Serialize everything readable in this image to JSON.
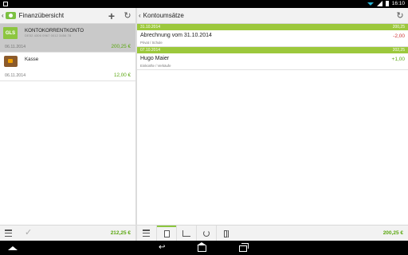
{
  "statusbar": {
    "time": "16:10",
    "icons": [
      "wifi-icon",
      "signal-icon",
      "battery-icon"
    ]
  },
  "left": {
    "title": "Finanzübersicht",
    "back_glyph": "‹",
    "actions": {
      "add_glyph": "+",
      "sync_glyph": "↻"
    },
    "accounts": [
      {
        "badge": "GLS",
        "name": "KONTOKORRENTKONTO",
        "sub": "DE52 4306 0967 0012 3456 78",
        "date": "06.11.2014",
        "amount": "200,25 €",
        "selected": true
      },
      {
        "badge": "",
        "icon": "wallet-icon",
        "name": "Kasse",
        "sub": "",
        "date": "06.11.2014",
        "amount": "12,00 €",
        "selected": false
      }
    ],
    "bottom": {
      "check_glyph": "✓",
      "total": "212,25 €"
    }
  },
  "right": {
    "title": "Kontoumsätze",
    "back_glyph": "‹",
    "sync_glyph": "↻",
    "groups": [
      {
        "date": "31.10.2014",
        "balance": "200,25",
        "transactions": [
          {
            "title": "Abrechnung vom  31.10.2014",
            "category": "Privat / Schule",
            "amount": "-2,00",
            "sign": "neg"
          }
        ]
      },
      {
        "date": "07.10.2014",
        "balance": "202,25",
        "transactions": [
          {
            "title": "Hugo Maier",
            "category": "Einkünfte / Verkäufe",
            "amount": "+1,00",
            "sign": "pos"
          }
        ]
      }
    ],
    "bottom": {
      "total": "200,25 €",
      "tabs": [
        "calculator-icon",
        "chart-icon",
        "refresh-icon",
        "document-icon"
      ]
    }
  },
  "colors": {
    "accent": "#8cc63f",
    "positive": "#5aa70f",
    "negative": "#cc3333"
  }
}
